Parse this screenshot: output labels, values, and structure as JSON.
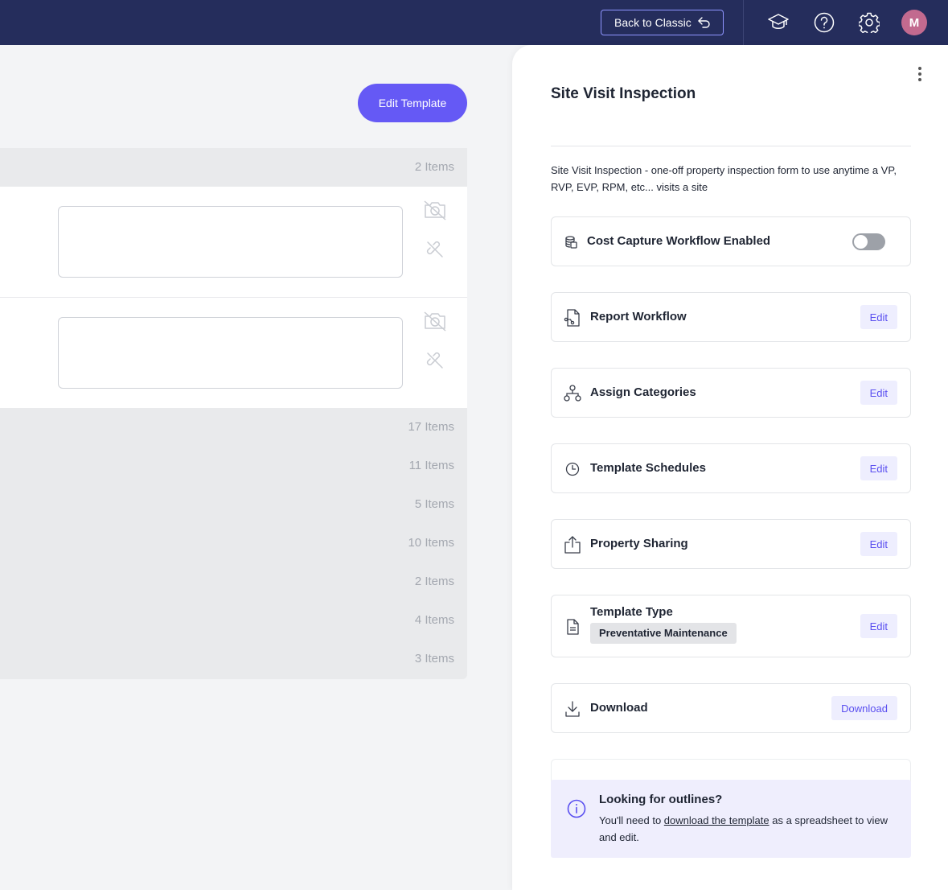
{
  "topbar": {
    "back_label": "Back to Classic",
    "avatar_initial": "M",
    "icons": [
      "graduation-cap-icon",
      "help-icon",
      "settings-icon"
    ]
  },
  "main": {
    "edit_template_label": "Edit Template",
    "first_section_count": "2 Items",
    "section_counts": [
      "17 Items",
      "11 Items",
      "5 Items",
      "10 Items",
      "2 Items",
      "4 Items",
      "3 Items"
    ]
  },
  "panel": {
    "title": "Site Visit Inspection",
    "description": "Site Visit Inspection - one-off property inspection form to use anytime a VP, RVP, EVP, RPM, etc... visits a site",
    "cost_capture": {
      "label": "Cost Capture Workflow Enabled",
      "enabled": false
    },
    "report_workflow": {
      "label": "Report Workflow",
      "button": "Edit"
    },
    "assign_categories": {
      "label": "Assign Categories",
      "button": "Edit"
    },
    "template_schedules": {
      "label": "Template Schedules",
      "button": "Edit"
    },
    "property_sharing": {
      "label": "Property Sharing",
      "button": "Edit"
    },
    "template_type": {
      "label": "Template Type",
      "value": "Preventative Maintenance",
      "button": "Edit"
    },
    "download": {
      "label": "Download",
      "button": "Download"
    },
    "info": {
      "title": "Looking for outlines?",
      "text_before": "You'll need to ",
      "link": "download the template",
      "text_after": " as a spreadsheet to view and edit."
    }
  },
  "colors": {
    "topbar": "#252d5c",
    "accent": "#6559f5",
    "avatar": "#c26a8f"
  }
}
